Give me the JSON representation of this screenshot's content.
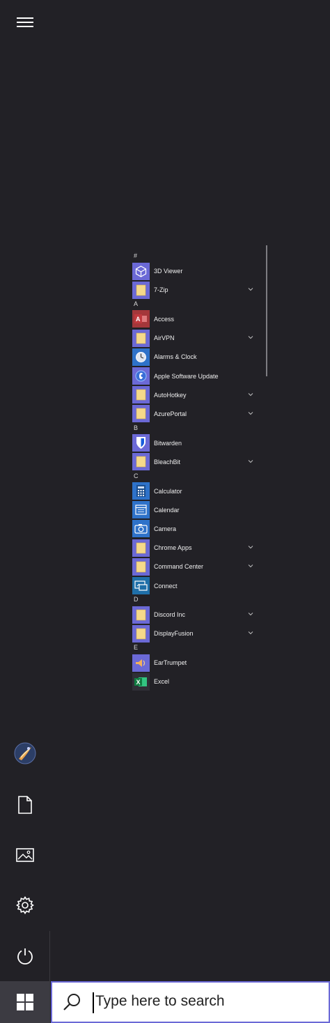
{
  "start_menu": {
    "groups": [
      {
        "letter": "#",
        "apps": [
          {
            "name": "3D Viewer",
            "icon": "3d-viewer-icon",
            "expandable": false,
            "tile": "#6b69d6"
          },
          {
            "name": "7-Zip",
            "icon": "folder-icon",
            "expandable": true,
            "tile": "#6b69d6"
          }
        ]
      },
      {
        "letter": "A",
        "apps": [
          {
            "name": "Access",
            "icon": "access-icon",
            "expandable": false,
            "tile": "#a4373a"
          },
          {
            "name": "AirVPN",
            "icon": "folder-icon",
            "expandable": true,
            "tile": "#6b69d6"
          },
          {
            "name": "Alarms & Clock",
            "icon": "alarm-clock-icon",
            "expandable": false,
            "tile": "#2e72c9"
          },
          {
            "name": "Apple Software Update",
            "icon": "apple-update-icon",
            "expandable": false,
            "tile": "#6b69d6"
          },
          {
            "name": "AutoHotkey",
            "icon": "folder-icon",
            "expandable": true,
            "tile": "#6b69d6"
          },
          {
            "name": "AzurePortal",
            "icon": "folder-icon",
            "expandable": true,
            "tile": "#6b69d6"
          }
        ]
      },
      {
        "letter": "B",
        "apps": [
          {
            "name": "Bitwarden",
            "icon": "bitwarden-icon",
            "expandable": false,
            "tile": "#6b69d6"
          },
          {
            "name": "BleachBit",
            "icon": "folder-icon",
            "expandable": true,
            "tile": "#6b69d6"
          }
        ]
      },
      {
        "letter": "C",
        "apps": [
          {
            "name": "Calculator",
            "icon": "calculator-icon",
            "expandable": false,
            "tile": "#2e72c9"
          },
          {
            "name": "Calendar",
            "icon": "calendar-icon",
            "expandable": false,
            "tile": "#2e72c9"
          },
          {
            "name": "Camera",
            "icon": "camera-icon",
            "expandable": false,
            "tile": "#2e72c9"
          },
          {
            "name": "Chrome Apps",
            "icon": "folder-icon",
            "expandable": true,
            "tile": "#6b69d6"
          },
          {
            "name": "Command Center",
            "icon": "folder-icon",
            "expandable": true,
            "tile": "#6b69d6"
          },
          {
            "name": "Connect",
            "icon": "connect-icon",
            "expandable": false,
            "tile": "#1f6fa8"
          }
        ]
      },
      {
        "letter": "D",
        "apps": [
          {
            "name": "Discord Inc",
            "icon": "folder-icon",
            "expandable": true,
            "tile": "#6b69d6"
          },
          {
            "name": "DisplayFusion",
            "icon": "folder-icon",
            "expandable": true,
            "tile": "#6b69d6"
          }
        ]
      },
      {
        "letter": "E",
        "apps": [
          {
            "name": "EarTrumpet",
            "icon": "eartrumpet-icon",
            "expandable": false,
            "tile": "#6b69d6"
          },
          {
            "name": "Excel",
            "icon": "excel-icon",
            "expandable": false,
            "tile": "#2f2f36"
          }
        ]
      }
    ]
  },
  "rail": {
    "menu_icon": "hamburger-menu-icon",
    "items": [
      "user-avatar",
      "documents-icon",
      "pictures-icon",
      "settings-gear-icon",
      "power-icon"
    ]
  },
  "taskbar": {
    "start_icon": "windows-logo-icon",
    "search_icon": "search-icon",
    "search_placeholder": "Type here to search"
  }
}
